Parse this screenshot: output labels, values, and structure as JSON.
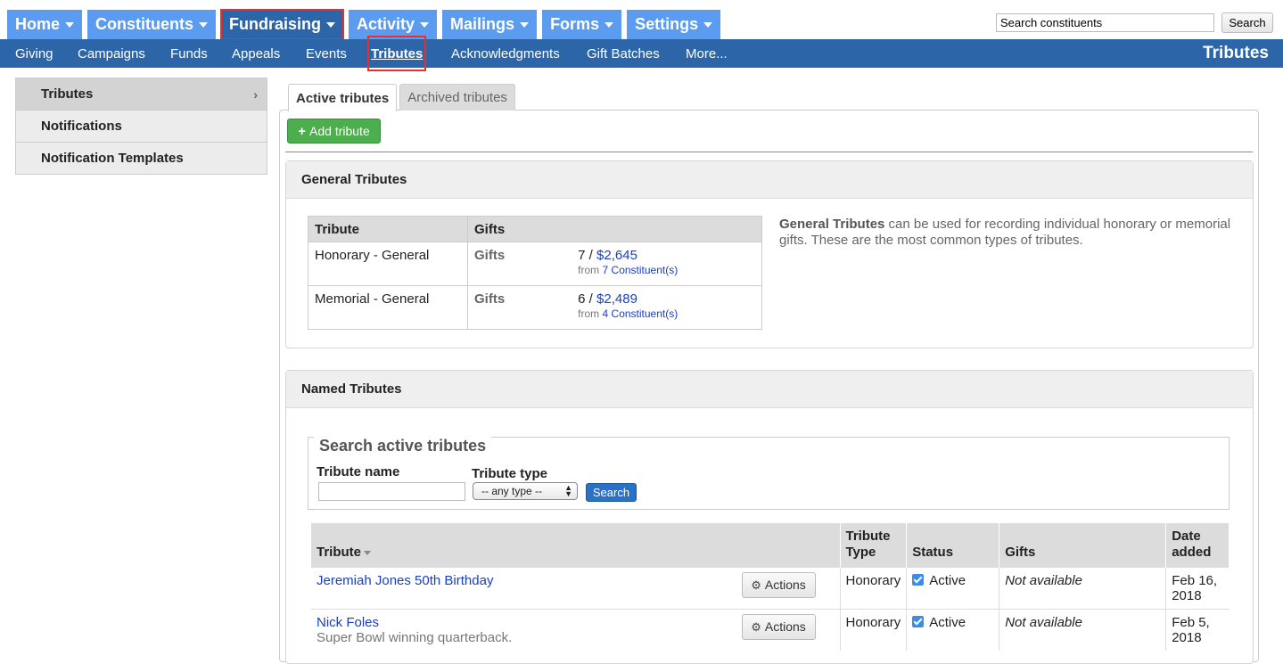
{
  "topnav": [
    {
      "label": "Home",
      "active": false
    },
    {
      "label": "Constituents",
      "active": false
    },
    {
      "label": "Fundraising",
      "active": true
    },
    {
      "label": "Activity",
      "active": false
    },
    {
      "label": "Mailings",
      "active": false
    },
    {
      "label": "Forms",
      "active": false
    },
    {
      "label": "Settings",
      "active": false
    }
  ],
  "top_search": {
    "value": "Search constituents",
    "button": "Search"
  },
  "subnav": {
    "items": [
      {
        "label": "Giving"
      },
      {
        "label": "Campaigns"
      },
      {
        "label": "Funds"
      },
      {
        "label": "Appeals"
      },
      {
        "label": "Events"
      },
      {
        "label": "Tributes",
        "active": true
      },
      {
        "label": "Acknowledgments"
      },
      {
        "label": "Gift Batches"
      },
      {
        "label": "More..."
      }
    ],
    "section_title": "Tributes"
  },
  "sidebar": {
    "items": [
      {
        "label": "Tributes",
        "active": true
      },
      {
        "label": "Notifications"
      },
      {
        "label": "Notification Templates"
      }
    ]
  },
  "tabs": [
    {
      "label": "Active tributes",
      "active": true
    },
    {
      "label": "Archived tributes",
      "active": false
    }
  ],
  "add_button": "Add tribute",
  "general": {
    "heading": "General Tributes",
    "columns": [
      "Tribute",
      "Gifts"
    ],
    "rows": [
      {
        "tribute": "Honorary - General",
        "gifts_label": "Gifts",
        "count": "7 /",
        "amount": "$2,645",
        "from": "from",
        "constituents": "7 Constituent(s)"
      },
      {
        "tribute": "Memorial - General",
        "gifts_label": "Gifts",
        "count": "6 /",
        "amount": "$2,489",
        "from": "from",
        "constituents": "4 Constituent(s)"
      }
    ],
    "desc_bold": "General Tributes",
    "desc_rest": " can be used for recording individual honorary or memorial gifts. These are the most common types of tributes."
  },
  "named": {
    "heading": "Named Tributes",
    "search": {
      "legend": "Search active tributes",
      "name_label": "Tribute name",
      "name_value": "",
      "type_label": "Tribute type",
      "type_selected": "-- any type --",
      "button": "Search"
    },
    "columns": {
      "tribute": "Tribute",
      "type_line1": "Tribute",
      "type_line2": "Type",
      "status": "Status",
      "gifts": "Gifts",
      "date_line1": "Date",
      "date_line2": "added"
    },
    "actions_label": "Actions",
    "rows": [
      {
        "name": "Jeremiah Jones 50th Birthday",
        "description": "",
        "type": "Honorary",
        "status": "Active",
        "gifts": "Not available",
        "date_line1": "Feb 16,",
        "date_line2": "2018"
      },
      {
        "name": "Nick Foles",
        "description": "Super Bowl winning quarterback.",
        "type": "Honorary",
        "status": "Active",
        "gifts": "Not available",
        "date_line1": "Feb 5,",
        "date_line2": "2018"
      }
    ]
  }
}
